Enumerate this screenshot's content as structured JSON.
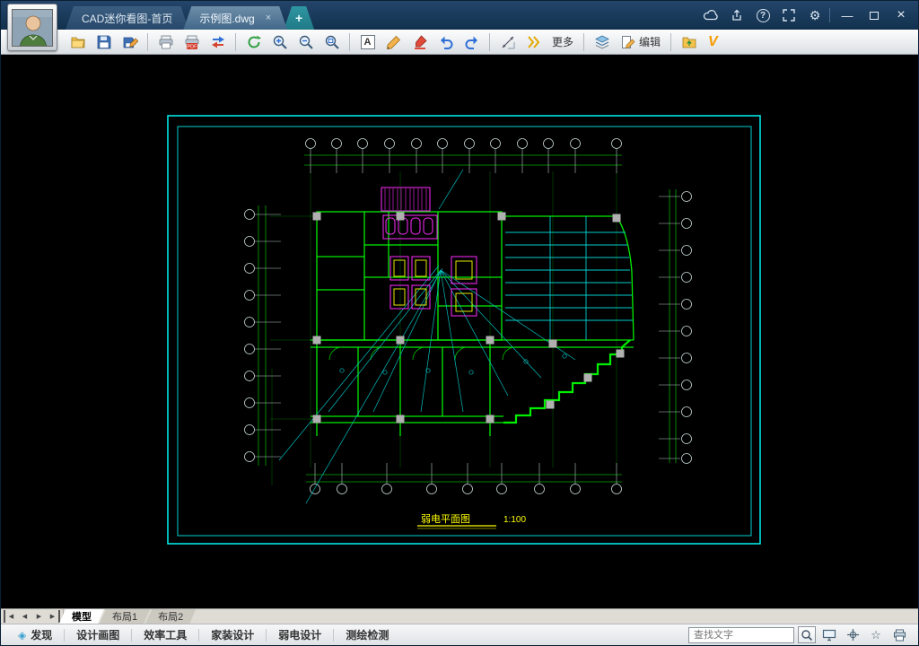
{
  "titlebar": {
    "tabs": {
      "home": "CAD迷你看图-首页",
      "document": "示例图.dwg"
    },
    "new_tab_glyph": "+",
    "tab_close_glyph": "×",
    "help_glyph": "?",
    "gear_glyph": "⚙",
    "minimize_glyph": "—",
    "close_glyph": "×"
  },
  "toolbar": {
    "text_tool_glyph": "A",
    "pdf_badge": "PDF",
    "more_label": "更多",
    "edit_label": "编辑",
    "logo_glyph": "V"
  },
  "canvas": {
    "drawing_title": "弱电平面图",
    "drawing_scale": "1:100"
  },
  "sheet_bar": {
    "nav_first_glyph": "◀",
    "nav_prev_glyph": "◀",
    "nav_next_glyph": "▶",
    "nav_last_glyph": "▶",
    "tabs": [
      {
        "label": "模型"
      },
      {
        "label": "布局1"
      },
      {
        "label": "布局2"
      }
    ]
  },
  "bottom_bar": {
    "discover_glyph": "◈",
    "items": [
      {
        "label": "发现"
      },
      {
        "label": "设计画图"
      },
      {
        "label": "效率工具"
      },
      {
        "label": "家装设计"
      },
      {
        "label": "弱电设计"
      },
      {
        "label": "测绘检测"
      }
    ],
    "search_placeholder": "查找文字",
    "star_glyph": "☆"
  },
  "colors": {
    "frame_cyan": "#00e5e5",
    "wall_green": "#00ee00",
    "detail_magenta": "#ff2aff",
    "caption_yellow": "#ffff00"
  }
}
